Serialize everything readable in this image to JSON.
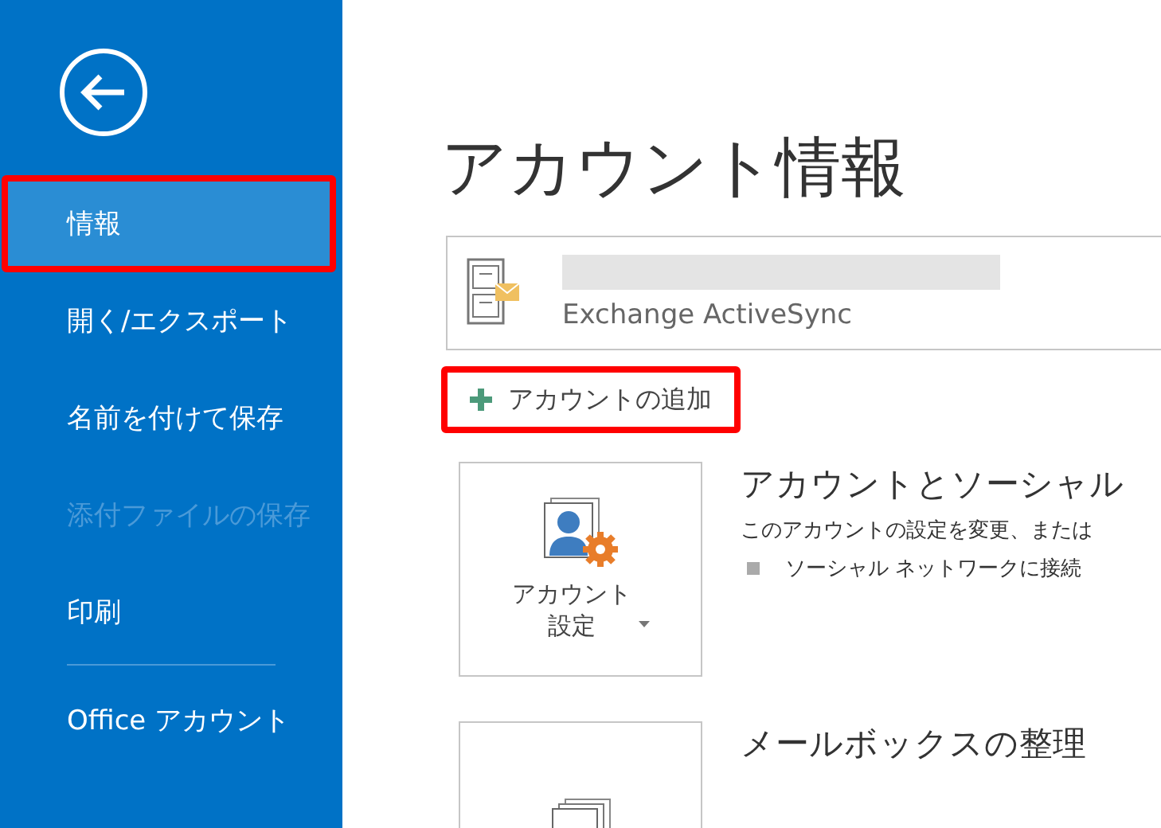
{
  "sidebar": {
    "items": [
      {
        "label": "情報",
        "selected": true,
        "disabled": false,
        "highlighted": true,
        "separator_before": false
      },
      {
        "label": "開く/エクスポート",
        "selected": false,
        "disabled": false,
        "highlighted": false,
        "separator_before": false
      },
      {
        "label": "名前を付けて保存",
        "selected": false,
        "disabled": false,
        "highlighted": false,
        "separator_before": false
      },
      {
        "label": "添付ファイルの保存",
        "selected": false,
        "disabled": true,
        "highlighted": false,
        "separator_before": false
      },
      {
        "label": "印刷",
        "selected": false,
        "disabled": false,
        "highlighted": false,
        "separator_before": false
      },
      {
        "label": "Office アカウント",
        "selected": false,
        "disabled": false,
        "highlighted": false,
        "separator_before": true
      }
    ]
  },
  "page_title": "アカウント情報",
  "account": {
    "type": "Exchange ActiveSync"
  },
  "add_account_button": {
    "label": "アカウントの追加",
    "highlighted": true
  },
  "sections": [
    {
      "kind": "settings",
      "button_label": [
        "アカウント",
        "設定"
      ],
      "heading": "アカウントとソーシャル",
      "description": "このアカウントの設定を変更、または",
      "bullets": [
        "ソーシャル ネットワークに接続"
      ]
    },
    {
      "kind": "mailbox",
      "heading": "メールボックスの整理"
    }
  ]
}
